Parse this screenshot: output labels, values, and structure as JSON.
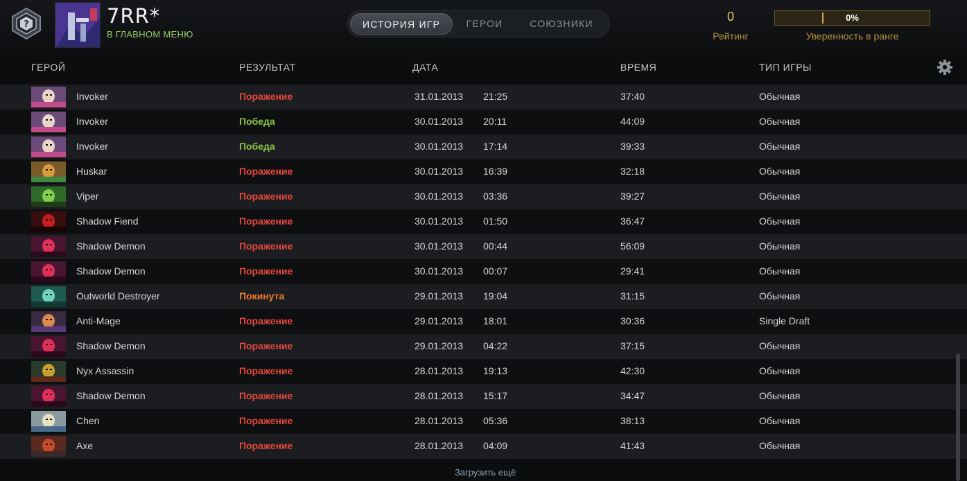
{
  "profile": {
    "name": "7RR*",
    "status": "В ГЛАВНОМ МЕНЮ",
    "rank_badge_icon": "rank-unknown-icon"
  },
  "tabs": [
    {
      "label": "ИСТОРИЯ ИГР",
      "active": true
    },
    {
      "label": "ГЕРОИ",
      "active": false
    },
    {
      "label": "СОЮЗНИКИ",
      "active": false
    }
  ],
  "rating": {
    "value": "0",
    "label": "Рейтинг"
  },
  "confidence": {
    "value": "0%",
    "label": "Уверенность в ранге",
    "fraction": 0.0
  },
  "columns": {
    "hero": "ГЕРОЙ",
    "result": "РЕЗУЛЬТАТ",
    "date": "ДАТА",
    "duration": "ВРЕМЯ",
    "game_type": "ТИП ИГРЫ"
  },
  "colors": {
    "loss": "#e5483c",
    "win": "#8bc34a",
    "abandon": "#f07a2a"
  },
  "matches": [
    {
      "hero": "Invoker",
      "result": "Поражение",
      "outcome": "loss",
      "date": "31.01.2013",
      "time": "21:25",
      "duration": "37:40",
      "game_type": "Обычная"
    },
    {
      "hero": "Invoker",
      "result": "Победа",
      "outcome": "win",
      "date": "30.01.2013",
      "time": "20:11",
      "duration": "44:09",
      "game_type": "Обычная"
    },
    {
      "hero": "Invoker",
      "result": "Победа",
      "outcome": "win",
      "date": "30.01.2013",
      "time": "17:14",
      "duration": "39:33",
      "game_type": "Обычная"
    },
    {
      "hero": "Huskar",
      "result": "Поражение",
      "outcome": "loss",
      "date": "30.01.2013",
      "time": "16:39",
      "duration": "32:18",
      "game_type": "Обычная"
    },
    {
      "hero": "Viper",
      "result": "Поражение",
      "outcome": "loss",
      "date": "30.01.2013",
      "time": "03:36",
      "duration": "39:27",
      "game_type": "Обычная"
    },
    {
      "hero": "Shadow Fiend",
      "result": "Поражение",
      "outcome": "loss",
      "date": "30.01.2013",
      "time": "01:50",
      "duration": "36:47",
      "game_type": "Обычная"
    },
    {
      "hero": "Shadow Demon",
      "result": "Поражение",
      "outcome": "loss",
      "date": "30.01.2013",
      "time": "00:44",
      "duration": "56:09",
      "game_type": "Обычная"
    },
    {
      "hero": "Shadow Demon",
      "result": "Поражение",
      "outcome": "loss",
      "date": "30.01.2013",
      "time": "00:07",
      "duration": "29:41",
      "game_type": "Обычная"
    },
    {
      "hero": "Outworld Destroyer",
      "result": "Покинута",
      "outcome": "abandon",
      "date": "29.01.2013",
      "time": "19:04",
      "duration": "31:15",
      "game_type": "Обычная"
    },
    {
      "hero": "Anti-Mage",
      "result": "Поражение",
      "outcome": "loss",
      "date": "29.01.2013",
      "time": "18:01",
      "duration": "30:36",
      "game_type": "Single Draft"
    },
    {
      "hero": "Shadow Demon",
      "result": "Поражение",
      "outcome": "loss",
      "date": "29.01.2013",
      "time": "04:22",
      "duration": "37:15",
      "game_type": "Обычная"
    },
    {
      "hero": "Nyx Assassin",
      "result": "Поражение",
      "outcome": "loss",
      "date": "28.01.2013",
      "time": "19:13",
      "duration": "42:30",
      "game_type": "Обычная"
    },
    {
      "hero": "Shadow Demon",
      "result": "Поражение",
      "outcome": "loss",
      "date": "28.01.2013",
      "time": "15:17",
      "duration": "34:47",
      "game_type": "Обычная"
    },
    {
      "hero": "Chen",
      "result": "Поражение",
      "outcome": "loss",
      "date": "28.01.2013",
      "time": "05:36",
      "duration": "38:13",
      "game_type": "Обычная"
    },
    {
      "hero": "Axe",
      "result": "Поражение",
      "outcome": "loss",
      "date": "28.01.2013",
      "time": "04:09",
      "duration": "41:43",
      "game_type": "Обычная"
    }
  ],
  "load_more": "Загрузить ещё",
  "settings_icon": "gear-icon"
}
